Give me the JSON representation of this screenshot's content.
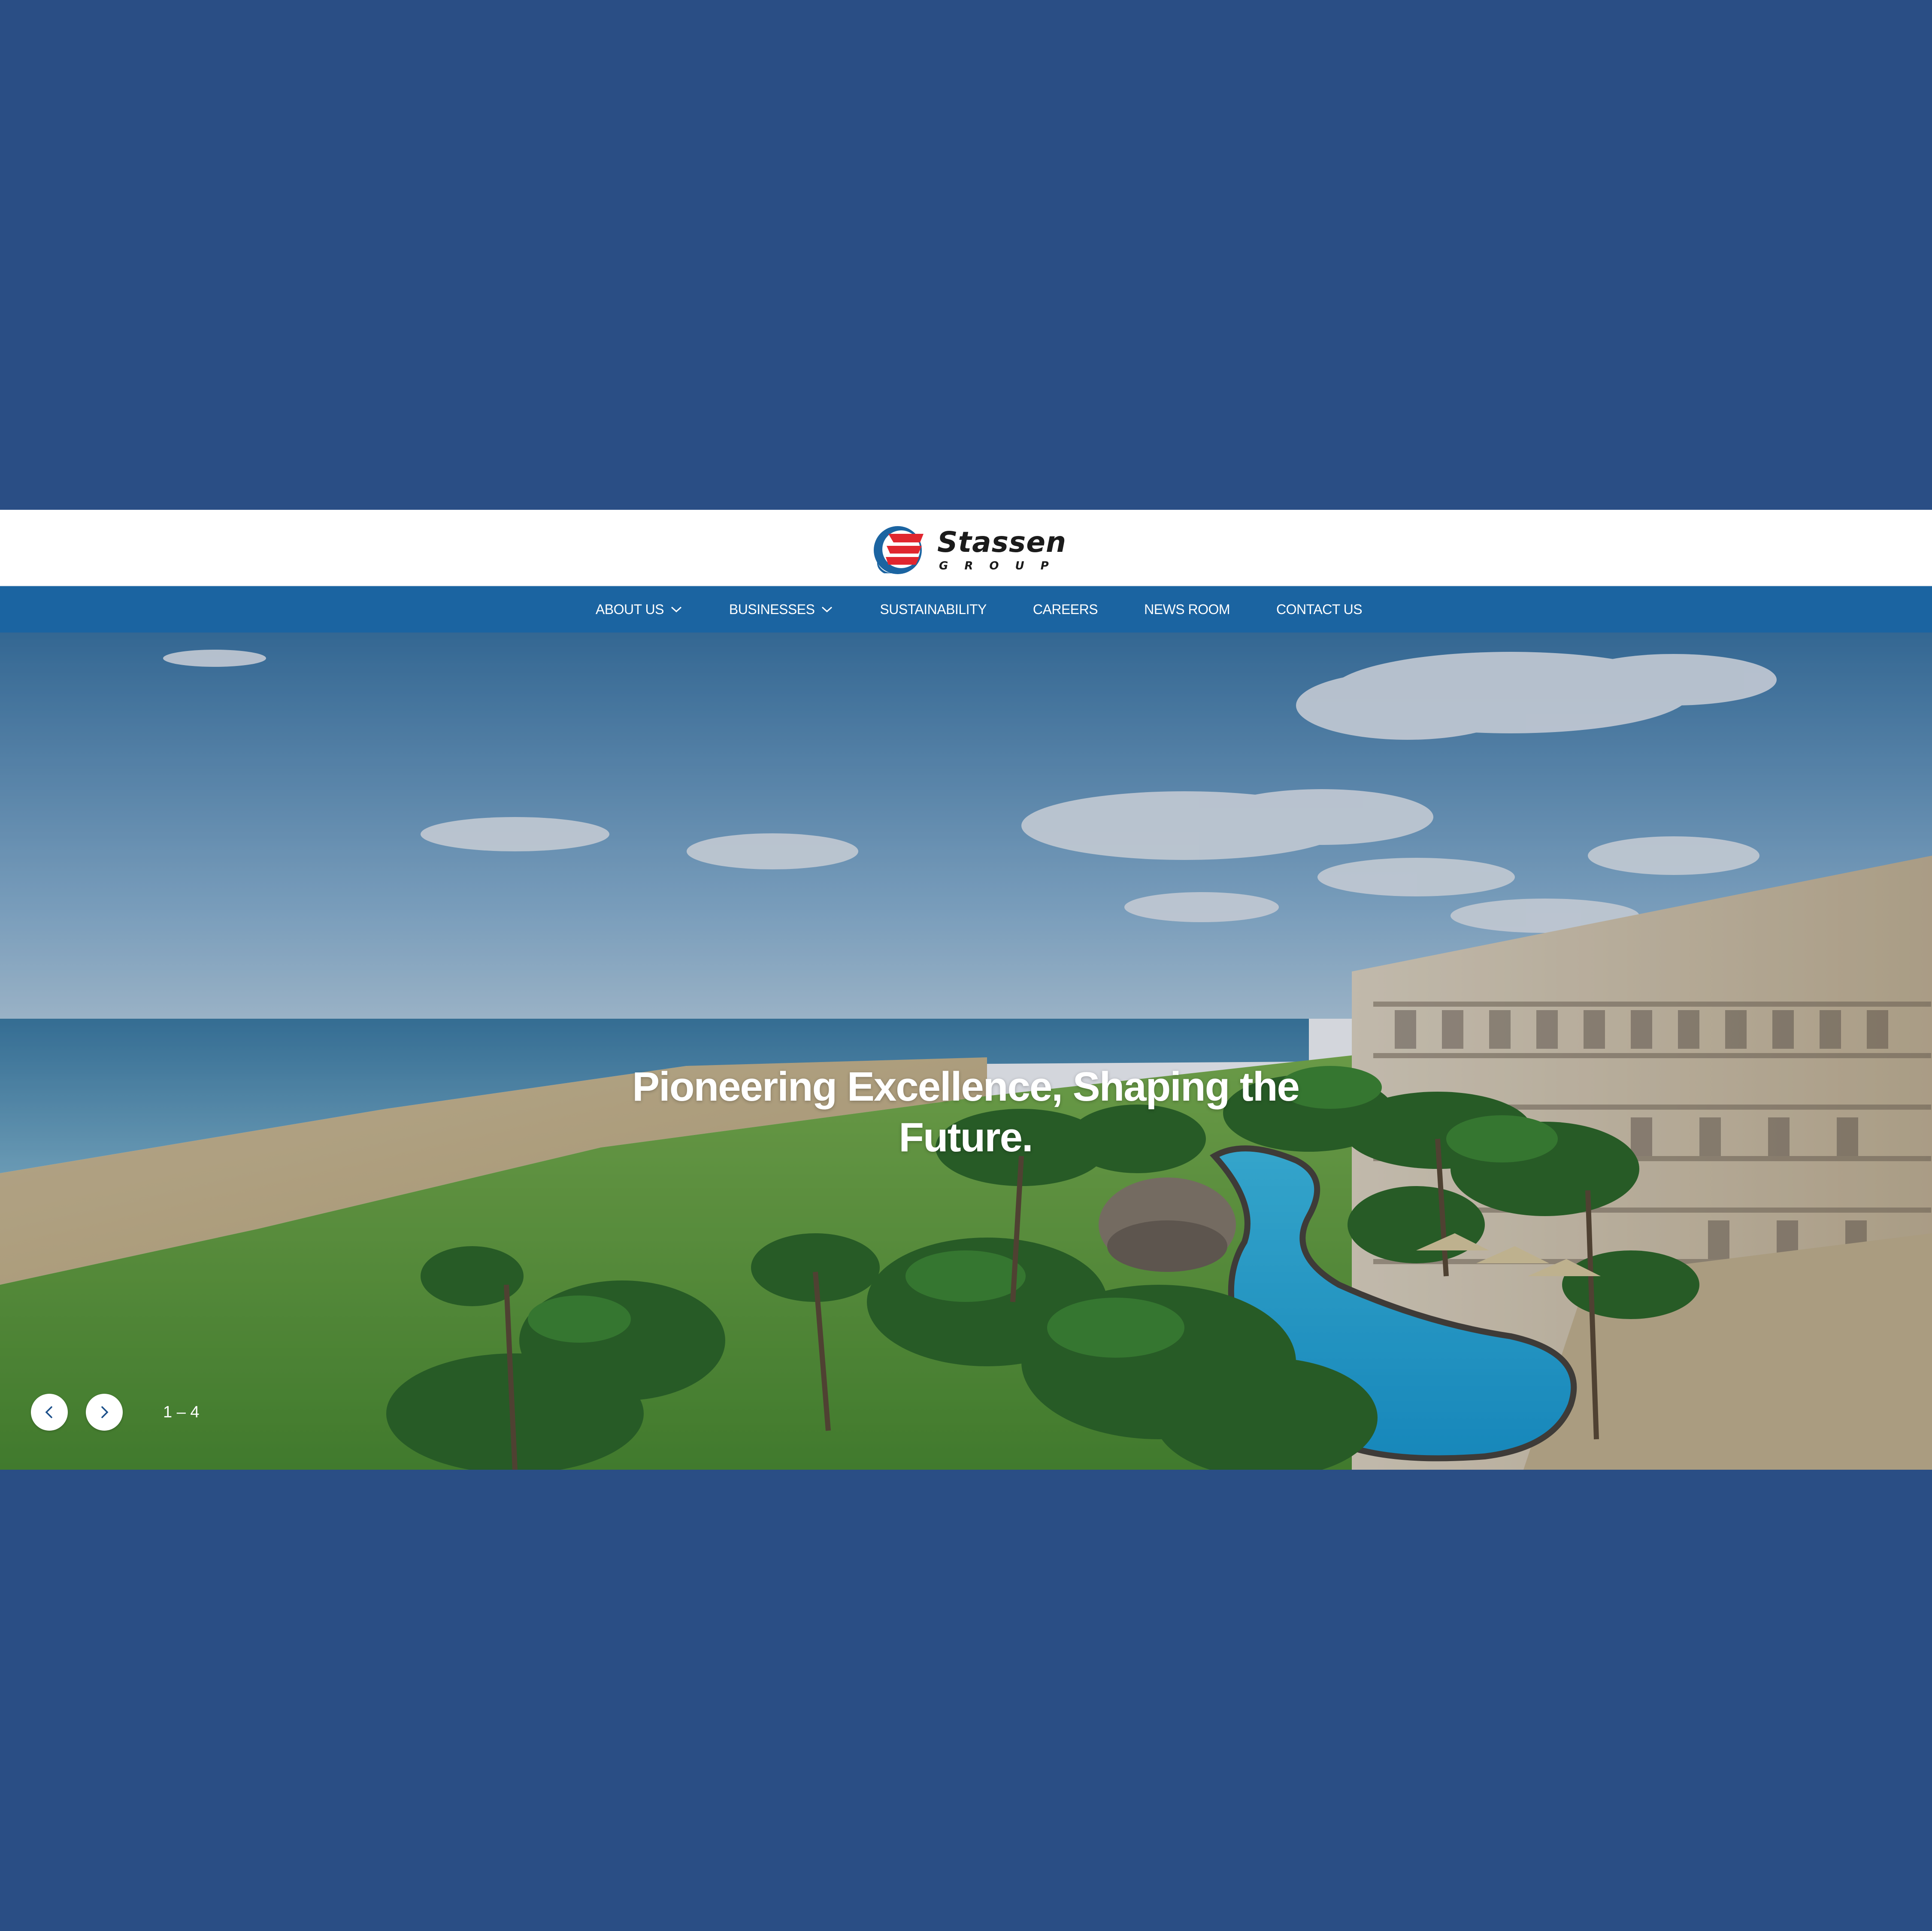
{
  "brand": {
    "name": "Stassen",
    "sub": "GROUP",
    "colors": {
      "blue": "#1b64a1",
      "red": "#e0262f",
      "background": "#2a4e85"
    }
  },
  "nav": {
    "items": [
      {
        "label": "ABOUT US",
        "has_dropdown": true
      },
      {
        "label": "BUSINESSES",
        "has_dropdown": true
      },
      {
        "label": "SUSTAINABILITY",
        "has_dropdown": false
      },
      {
        "label": "CAREERS",
        "has_dropdown": false
      },
      {
        "label": "NEWS ROOM",
        "has_dropdown": false
      },
      {
        "label": "CONTACT US",
        "has_dropdown": false
      }
    ]
  },
  "hero": {
    "title": "Pioneering Excellence, Shaping the Future.",
    "counter": "1 – 4",
    "prev_icon": "chevron-left-icon",
    "next_icon": "chevron-right-icon"
  }
}
